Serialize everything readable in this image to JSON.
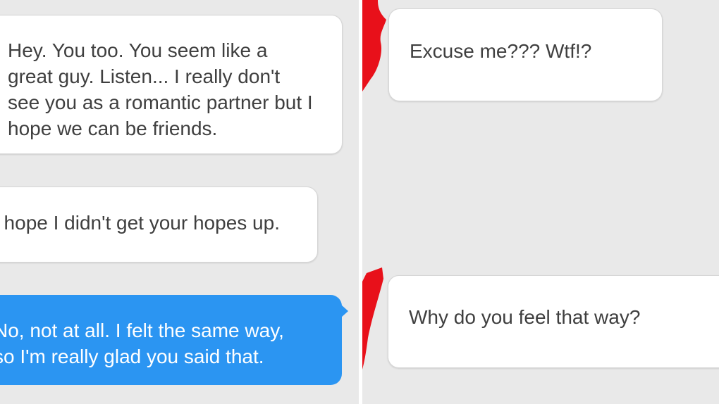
{
  "left_panel": {
    "messages": [
      {
        "type": "received",
        "lines": [
          "Hey. You too. You seem like a",
          "great guy. Listen... I really don't",
          "see you as a romantic partner but I",
          "hope we can be friends."
        ]
      },
      {
        "type": "received",
        "lines": [
          "I hope I didn't get your hopes up."
        ]
      },
      {
        "type": "sent",
        "lines": [
          "No, not at all. I felt the same way,",
          "so I'm really glad you said that."
        ]
      }
    ]
  },
  "right_panel": {
    "messages": [
      {
        "type": "received",
        "lines": [
          "Excuse me??? Wtf!?"
        ]
      },
      {
        "type": "received",
        "lines": [
          "Why do you feel that way?"
        ]
      }
    ]
  },
  "colors": {
    "background": "#e9e9e9",
    "received_bubble": "#ffffff",
    "sent_bubble": "#2b95f2",
    "accent_red": "#e8101a"
  },
  "icons": [
    "heart-sticker-top",
    "heart-sticker-bottom"
  ]
}
